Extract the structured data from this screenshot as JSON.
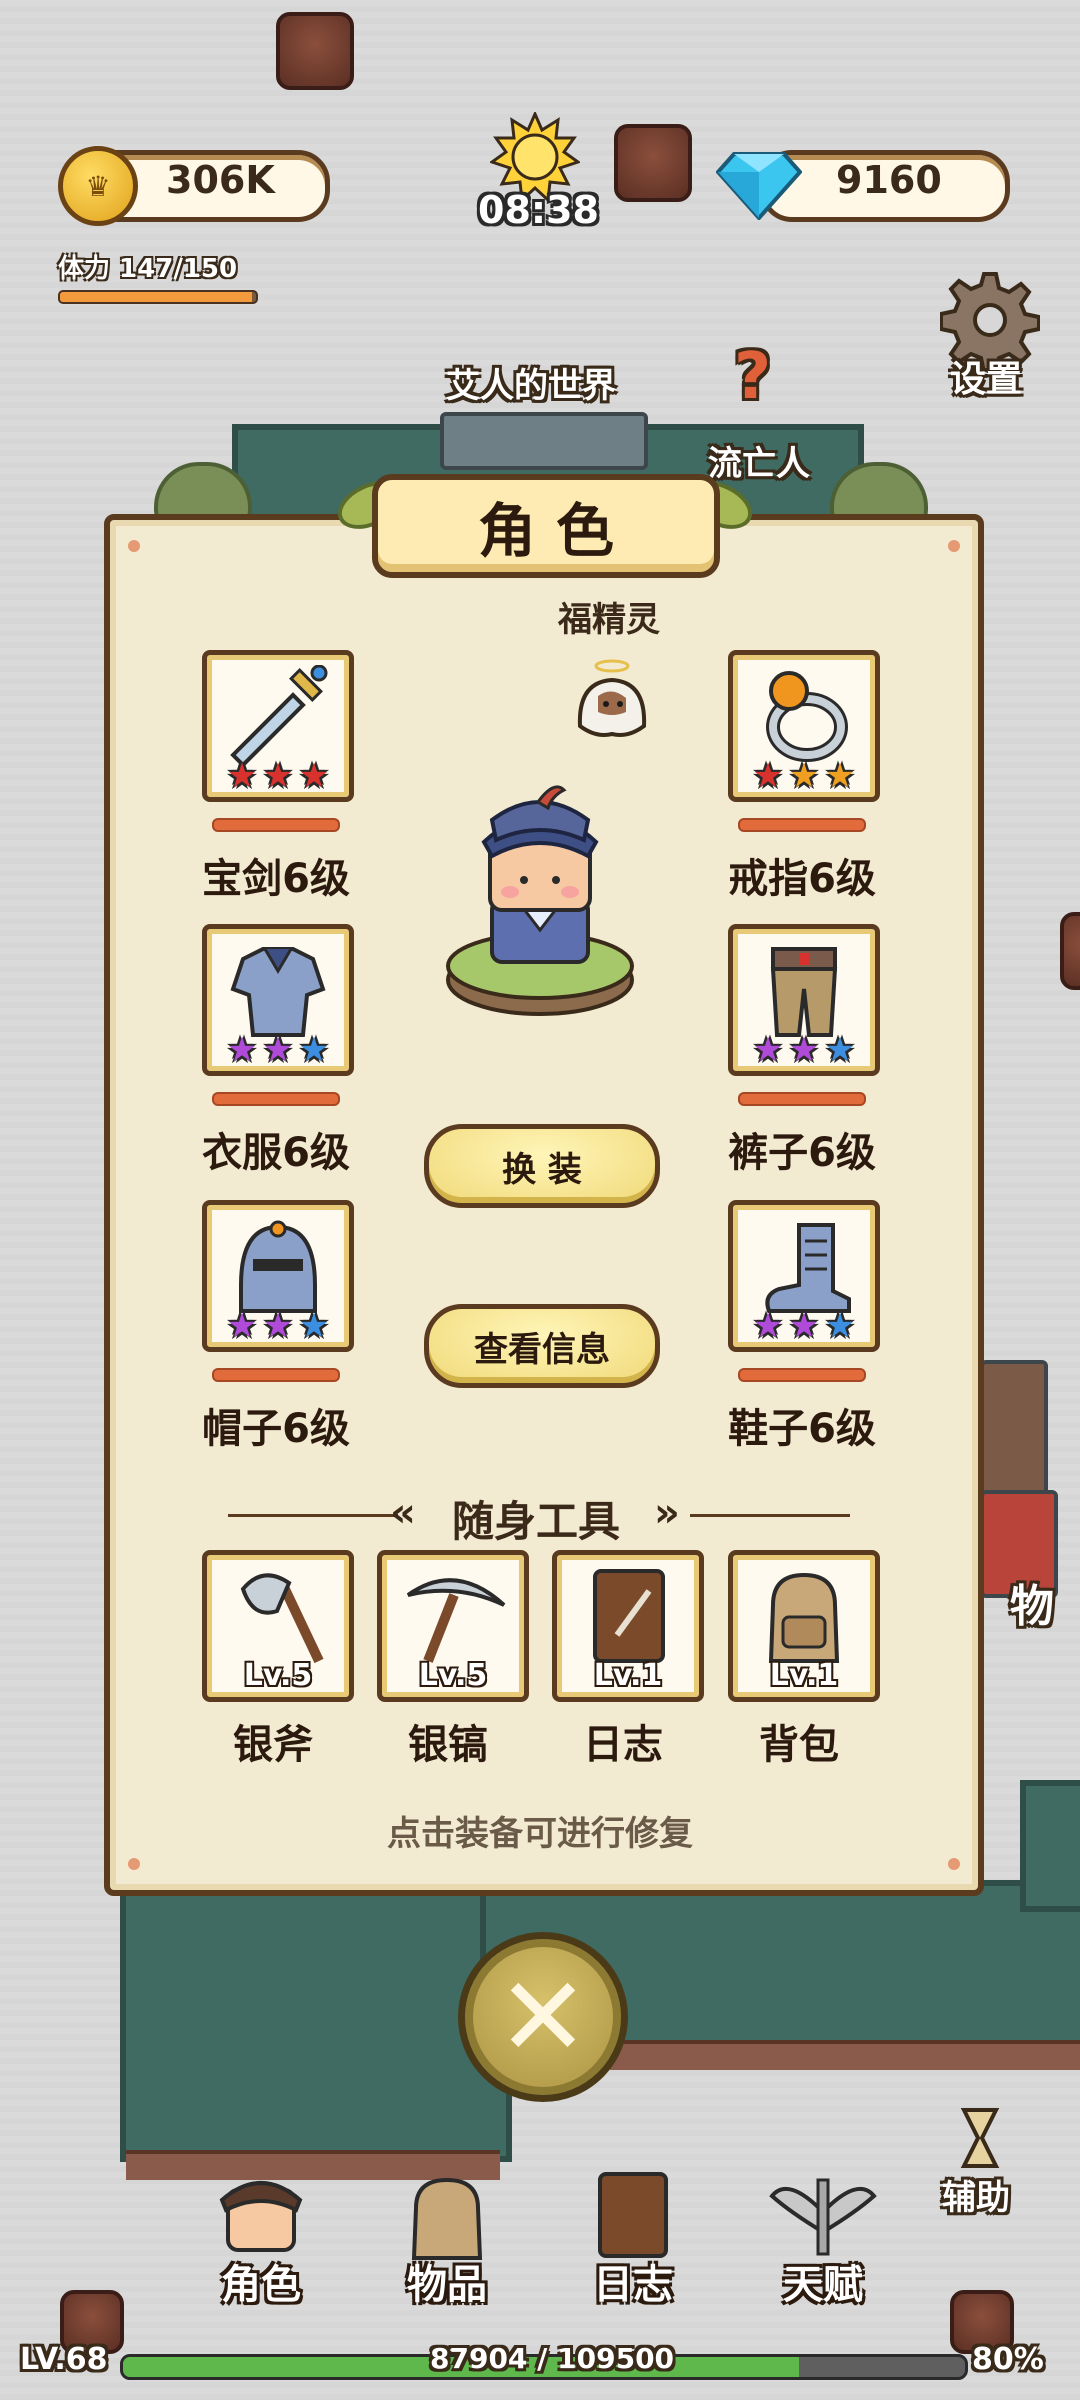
{
  "hud": {
    "gold": "306K",
    "gems": "9160",
    "clock": "08:38",
    "stamina_label": "体力 147/150",
    "stamina_fraction": 0.98,
    "settings_label": "设置"
  },
  "world": {
    "map_name": "艾人的世界",
    "npc_name": "流亡人",
    "side_label": "物"
  },
  "dialog": {
    "title": "角色",
    "pet_name": "福精灵",
    "equipment": [
      {
        "label": "宝剑6级",
        "icon": "sword-icon",
        "stars": [
          "red",
          "red",
          "red"
        ]
      },
      {
        "label": "戒指6级",
        "icon": "ring-icon",
        "stars": [
          "red",
          "orange",
          "orange"
        ]
      },
      {
        "label": "衣服6级",
        "icon": "armor-icon",
        "stars": [
          "purple",
          "purple",
          "blue"
        ]
      },
      {
        "label": "裤子6级",
        "icon": "pants-icon",
        "stars": [
          "purple",
          "purple",
          "blue"
        ]
      },
      {
        "label": "帽子6级",
        "icon": "helmet-icon",
        "stars": [
          "purple",
          "purple",
          "blue"
        ]
      },
      {
        "label": "鞋子6级",
        "icon": "boots-icon",
        "stars": [
          "purple",
          "purple",
          "blue"
        ]
      }
    ],
    "change_outfit_button": "换 装",
    "view_info_button": "查看信息",
    "tools_header": "随身工具",
    "tools": [
      {
        "label": "银斧",
        "level": "Lv.5",
        "icon": "axe-icon"
      },
      {
        "label": "银镐",
        "level": "Lv.5",
        "icon": "pickaxe-icon"
      },
      {
        "label": "日志",
        "level": "Lv.1",
        "icon": "journal-icon"
      },
      {
        "label": "背包",
        "level": "Lv.1",
        "icon": "backpack-icon"
      }
    ],
    "hint": "点击装备可进行修复"
  },
  "assist_label": "辅助",
  "nav": [
    {
      "label": "角色",
      "icon": "character-icon"
    },
    {
      "label": "物品",
      "icon": "bag-icon"
    },
    {
      "label": "日志",
      "icon": "book-icon"
    },
    {
      "label": "天赋",
      "icon": "wings-icon"
    }
  ],
  "footer": {
    "level": "LV.68",
    "xp": "87904 / 109500",
    "xp_fraction": 0.803,
    "percent": "80%"
  },
  "colors": {
    "star_red": "#d8322e",
    "star_orange": "#f0a020",
    "star_purple": "#b04ad8",
    "star_blue": "#3c8fe0"
  }
}
